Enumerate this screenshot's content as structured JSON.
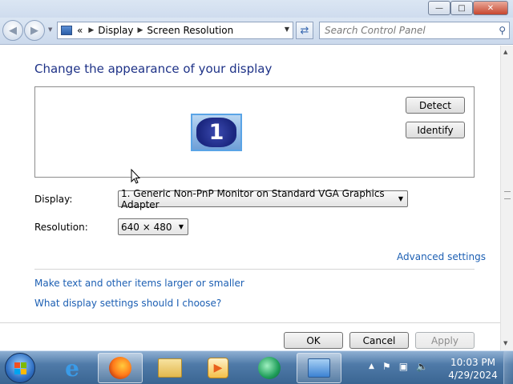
{
  "window": {
    "title_buttons": [
      "minimize",
      "maximize",
      "close"
    ]
  },
  "nav": {
    "breadcrumb_prefix": "«",
    "breadcrumbs": [
      "Display",
      "Screen Resolution"
    ],
    "search_placeholder": "Search Control Panel"
  },
  "main": {
    "heading": "Change the appearance of your display",
    "monitor_number": "1",
    "detect_label": "Detect",
    "identify_label": "Identify",
    "display_label": "Display:",
    "display_value": "1. Generic Non-PnP Monitor on Standard VGA Graphics Adapter",
    "resolution_label": "Resolution:",
    "resolution_value": "640 × 480",
    "advanced_link": "Advanced settings",
    "link_text_size": "Make text and other items larger or smaller",
    "link_which_settings": "What display settings should I choose?"
  },
  "footer": {
    "ok_label": "OK",
    "cancel_label": "Cancel",
    "apply_label": "Apply"
  },
  "taskbar": {
    "apps": [
      "start-button",
      "internet-explorer-icon",
      "firefox-icon",
      "windows-explorer-icon",
      "media-player-icon",
      "media-center-icon",
      "control-panel-icon"
    ],
    "time": "10:03 PM",
    "date": "4/29/2024"
  },
  "colors": {
    "heading": "#1e3287",
    "link": "#1c5fb3",
    "taskbar": "#4f7aa8"
  }
}
